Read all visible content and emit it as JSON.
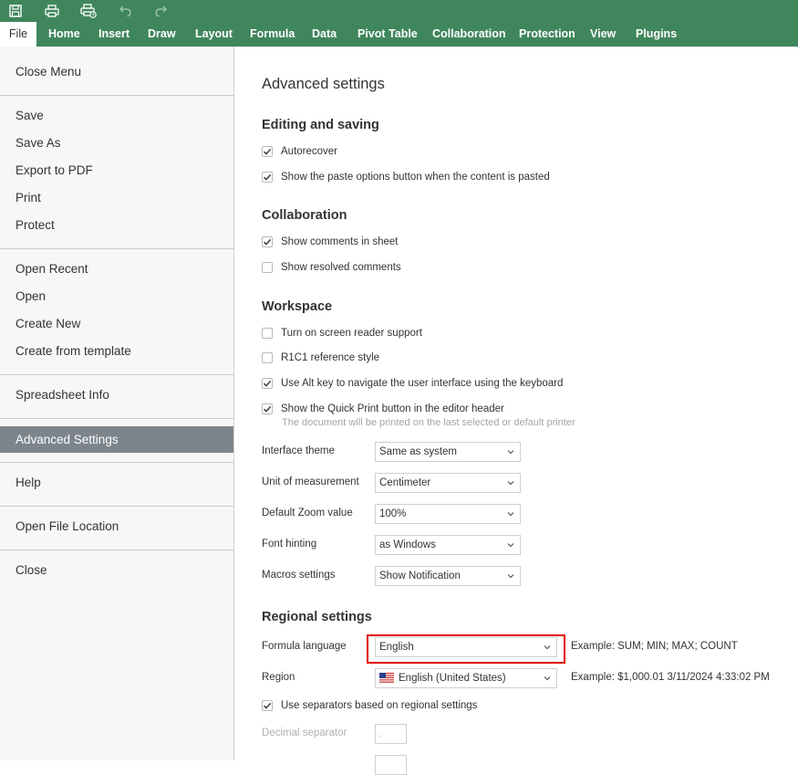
{
  "toolbar": {
    "icons": [
      "save-icon",
      "print-icon",
      "quick-print-icon",
      "undo-icon",
      "redo-icon"
    ]
  },
  "tabs": [
    "File",
    "Home",
    "Insert",
    "Draw",
    "Layout",
    "Formula",
    "Data",
    "Pivot Table",
    "Collaboration",
    "Protection",
    "View",
    "Plugins"
  ],
  "menu": {
    "close_menu": "Close Menu",
    "save": "Save",
    "save_as": "Save As",
    "export_pdf": "Export to PDF",
    "print": "Print",
    "protect": "Protect",
    "open_recent": "Open Recent",
    "open": "Open",
    "create_new": "Create New",
    "create_template": "Create from template",
    "spreadsheet_info": "Spreadsheet Info",
    "advanced_settings": "Advanced Settings",
    "help": "Help",
    "open_file_location": "Open File Location",
    "close": "Close"
  },
  "settings": {
    "title": "Advanced settings",
    "editing": {
      "heading": "Editing and saving",
      "autorecover": {
        "label": "Autorecover",
        "checked": true
      },
      "paste_options": {
        "label": "Show the paste options button when the content is pasted",
        "checked": true
      }
    },
    "collaboration": {
      "heading": "Collaboration",
      "show_comments": {
        "label": "Show comments in sheet",
        "checked": true
      },
      "show_resolved": {
        "label": "Show resolved comments",
        "checked": false
      }
    },
    "workspace": {
      "heading": "Workspace",
      "screen_reader": {
        "label": "Turn on screen reader support",
        "checked": false
      },
      "r1c1": {
        "label": "R1C1 reference style",
        "checked": false
      },
      "alt_key": {
        "label": "Use Alt key to navigate the user interface using the keyboard",
        "checked": true
      },
      "quick_print": {
        "label": "Show the Quick Print button in the editor header",
        "checked": true,
        "hint": "The document will be printed on the last selected or default printer"
      },
      "interface_theme": {
        "label": "Interface theme",
        "value": "Same as system"
      },
      "unit": {
        "label": "Unit of measurement",
        "value": "Centimeter"
      },
      "zoom": {
        "label": "Default Zoom value",
        "value": "100%"
      },
      "font_hinting": {
        "label": "Font hinting",
        "value": "as Windows"
      },
      "macros": {
        "label": "Macros settings",
        "value": "Show Notification"
      }
    },
    "regional": {
      "heading": "Regional settings",
      "formula_language": {
        "label": "Formula language",
        "value": "English",
        "example": "Example: SUM; MIN; MAX; COUNT"
      },
      "region": {
        "label": "Region",
        "value": "English (United States)",
        "example": "Example: $1,000.01 3/11/2024 4:33:02 PM",
        "flag": "us-flag-icon"
      },
      "separators": {
        "label": "Use separators based on regional settings",
        "checked": true
      },
      "decimal": {
        "label": "Decimal separator",
        "value": "."
      }
    }
  },
  "colors": {
    "brand": "#40865c",
    "selected_menu": "#7d858c",
    "highlight": "#e00000"
  }
}
